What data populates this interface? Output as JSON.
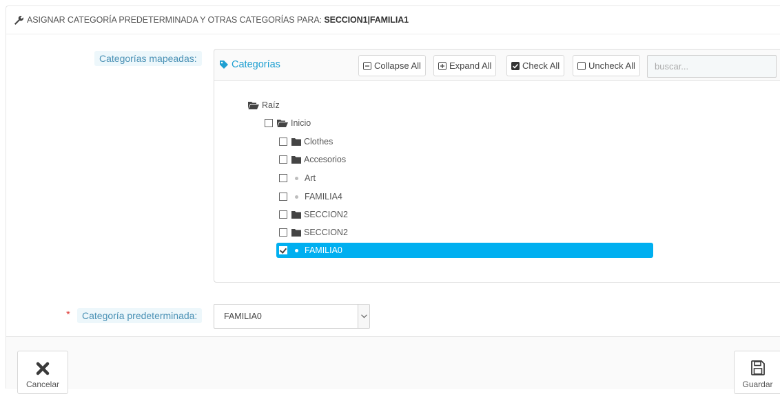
{
  "header": {
    "title_prefix": "ASIGNAR CATEGORÍA PREDETERMINADA Y OTRAS CATEGORÍAS PARA: ",
    "title_target": "SECCION1|FAMILIA1"
  },
  "form": {
    "mapped_label": "Categorías mapeadas:",
    "default_label": "Categoría predeterminada:",
    "required_mark": "*"
  },
  "tree": {
    "title": "Categorías",
    "buttons": {
      "collapse_all": "Collapse All",
      "expand_all": "Expand All",
      "check_all": "Check All",
      "uncheck_all": "Uncheck All"
    },
    "search_placeholder": "buscar...",
    "nodes": [
      {
        "label": "Raíz",
        "type": "folder-open",
        "checkbox": false,
        "checked": false
      },
      {
        "label": "Inicio",
        "type": "folder-open",
        "checkbox": true,
        "checked": false
      },
      {
        "label": "Clothes",
        "type": "folder",
        "checkbox": true,
        "checked": false
      },
      {
        "label": "Accesorios",
        "type": "folder",
        "checkbox": true,
        "checked": false
      },
      {
        "label": "Art",
        "type": "leaf",
        "checkbox": true,
        "checked": false
      },
      {
        "label": "FAMILIA4",
        "type": "leaf",
        "checkbox": true,
        "checked": false
      },
      {
        "label": "SECCION2",
        "type": "folder",
        "checkbox": true,
        "checked": false
      },
      {
        "label": "SECCION2",
        "type": "folder",
        "checkbox": true,
        "checked": false
      },
      {
        "label": "FAMILIA0",
        "type": "leaf",
        "checkbox": true,
        "checked": true
      }
    ]
  },
  "default_category": {
    "selected": "FAMILIA0"
  },
  "footer": {
    "cancel_label": "Cancelar",
    "save_label": "Guardar"
  },
  "colors": {
    "accent": "#00aff0",
    "label_text": "#4a91b5",
    "label_bg": "#edf7fb",
    "required": "#e0423e"
  }
}
